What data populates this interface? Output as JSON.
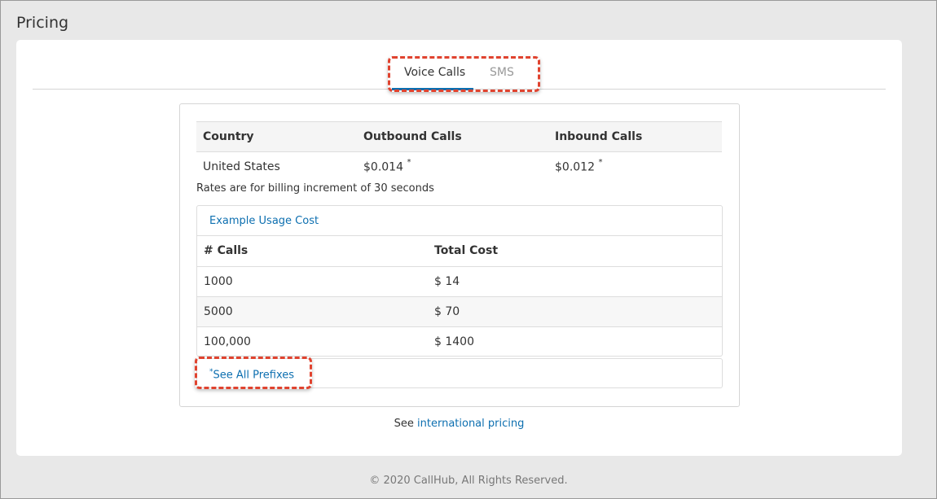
{
  "page": {
    "title": "Pricing"
  },
  "tabs": [
    {
      "label": "Voice Calls",
      "active": true
    },
    {
      "label": "SMS",
      "active": false
    }
  ],
  "rates": {
    "headers": [
      "Country",
      "Outbound Calls",
      "Inbound Calls"
    ],
    "row": {
      "country": "United States",
      "outbound": "$0.014",
      "inbound": "$0.012",
      "asterisk": "*"
    },
    "note": "Rates are for billing increment of 30 seconds"
  },
  "usage": {
    "title": "Example Usage Cost",
    "headers": [
      "# Calls",
      "Total Cost"
    ],
    "rows": [
      {
        "calls": "1000",
        "cost": "$ 14"
      },
      {
        "calls": "5000",
        "cost": "$ 70"
      },
      {
        "calls": "100,000",
        "cost": "$ 1400"
      }
    ]
  },
  "prefixes": {
    "asterisk": "*",
    "label": "See All Prefixes"
  },
  "international": {
    "prefix": "See",
    "link": "international pricing"
  },
  "footer": {
    "text": "© 2020 CallHub, All Rights Reserved."
  },
  "colors": {
    "link": "#0d6fb0",
    "highlight": "#e0432f"
  }
}
